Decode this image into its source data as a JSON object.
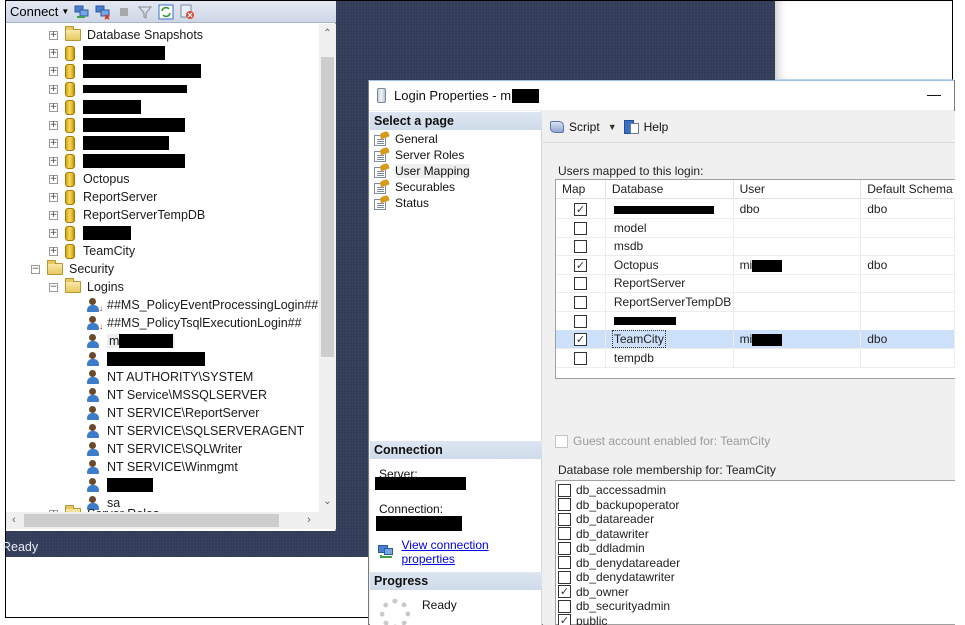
{
  "ssms": {
    "toolbar": {
      "connect_label": "Connect",
      "icons": [
        "connect-object-explorer-icon",
        "disconnect-icon",
        "stop-icon",
        "filter-icon",
        "refresh-icon",
        "activity-monitor-icon"
      ]
    },
    "tree": {
      "database_snapshots": "Database Snapshots",
      "databases": [
        {
          "label": "",
          "redacted": true
        },
        {
          "label": "",
          "redacted": true
        },
        {
          "label": "",
          "redacted": true
        },
        {
          "label": "",
          "redacted": true
        },
        {
          "label": "",
          "redacted": true
        },
        {
          "label": "",
          "redacted": true
        },
        {
          "label": "",
          "redacted": true
        },
        {
          "label": "Octopus",
          "redacted": false
        },
        {
          "label": "ReportServer",
          "redacted": false
        },
        {
          "label": "ReportServerTempDB",
          "redacted": false
        },
        {
          "label": "",
          "redacted": true
        },
        {
          "label": "TeamCity",
          "redacted": false
        }
      ],
      "security": "Security",
      "logins_folder": "Logins",
      "logins": [
        {
          "label": "##MS_PolicyEventProcessingLogin##",
          "disabled": true
        },
        {
          "label": "##MS_PolicyTsqlExecutionLogin##",
          "disabled": true
        },
        {
          "label": "m",
          "redacted": true
        },
        {
          "label": "",
          "redacted": true
        },
        {
          "label": "NT AUTHORITY\\SYSTEM"
        },
        {
          "label": "NT Service\\MSSQLSERVER"
        },
        {
          "label": "NT SERVICE\\ReportServer"
        },
        {
          "label": "NT SERVICE\\SQLSERVERAGENT"
        },
        {
          "label": "NT SERVICE\\SQLWriter"
        },
        {
          "label": "NT SERVICE\\Winmgmt"
        },
        {
          "label": "",
          "redacted": true
        },
        {
          "label": "sa"
        }
      ],
      "server_roles": "Server Roles"
    },
    "status": "Ready"
  },
  "dialog": {
    "title": "Login Properties - m",
    "minimize": "—",
    "select_page_header": "Select a page",
    "pages": [
      {
        "label": "General",
        "selected": false
      },
      {
        "label": "Server Roles",
        "selected": false
      },
      {
        "label": "User Mapping",
        "selected": true
      },
      {
        "label": "Securables",
        "selected": false
      },
      {
        "label": "Status",
        "selected": false
      }
    ],
    "connection_header": "Connection",
    "server_label": "Server:",
    "connection_label": "Connection:",
    "view_connection_link": "View connection properties",
    "progress_header": "Progress",
    "progress_status": "Ready",
    "toolbar": {
      "script_label": "Script",
      "help_label": "Help"
    },
    "users_mapped_label": "Users mapped to this login:",
    "grid": {
      "columns": [
        "Map",
        "Database",
        "User",
        "Default Schema"
      ],
      "rows": [
        {
          "map": true,
          "database": "",
          "database_redacted": true,
          "user": "dbo",
          "schema": "dbo",
          "selected": false
        },
        {
          "map": false,
          "database": "model",
          "user": "",
          "schema": "",
          "selected": false
        },
        {
          "map": false,
          "database": "msdb",
          "user": "",
          "schema": "",
          "selected": false
        },
        {
          "map": true,
          "database": "Octopus",
          "user": "mi",
          "user_redacted": true,
          "schema": "dbo",
          "selected": false
        },
        {
          "map": false,
          "database": "ReportServer",
          "user": "",
          "schema": "",
          "selected": false
        },
        {
          "map": false,
          "database": "ReportServerTempDB",
          "user": "",
          "schema": "",
          "selected": false
        },
        {
          "map": false,
          "database": "",
          "database_redacted": true,
          "user": "",
          "schema": "",
          "selected": false
        },
        {
          "map": true,
          "database": "TeamCity",
          "user": "mi",
          "user_redacted": true,
          "schema": "dbo",
          "selected": true
        },
        {
          "map": false,
          "database": "tempdb",
          "user": "",
          "schema": "",
          "selected": false
        }
      ]
    },
    "guest_label": "Guest account enabled for: TeamCity",
    "guest_checked": false,
    "role_membership_label": "Database role membership for: TeamCity",
    "roles": [
      {
        "label": "db_accessadmin",
        "checked": false
      },
      {
        "label": "db_backupoperator",
        "checked": false
      },
      {
        "label": "db_datareader",
        "checked": false
      },
      {
        "label": "db_datawriter",
        "checked": false
      },
      {
        "label": "db_ddladmin",
        "checked": false
      },
      {
        "label": "db_denydatareader",
        "checked": false
      },
      {
        "label": "db_denydatawriter",
        "checked": false
      },
      {
        "label": "db_owner",
        "checked": true
      },
      {
        "label": "db_securityadmin",
        "checked": false
      },
      {
        "label": "public",
        "checked": true
      }
    ]
  }
}
